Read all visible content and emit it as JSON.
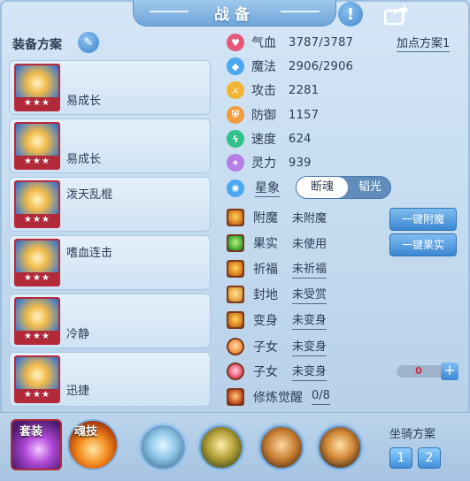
{
  "window": {
    "title": "战备"
  },
  "equipment": {
    "header": "装备方案",
    "items": [
      {
        "label": "易成长",
        "stars": "★★★"
      },
      {
        "label": "易成长",
        "stars": "★★★"
      },
      {
        "label": "泼天乱棍",
        "stars": "★★★"
      },
      {
        "label": "嗜血连击",
        "stars": "★★★"
      },
      {
        "label": "冷静",
        "stars": "★★★"
      },
      {
        "label": "迅捷",
        "stars": "★★★"
      }
    ]
  },
  "stats": {
    "plan_link": "加点方案1",
    "rows": [
      {
        "name": "气血",
        "value": "3787/3787",
        "icon": "heart-icon",
        "color": "#e6577a"
      },
      {
        "name": "魔法",
        "value": "2906/2906",
        "icon": "diamond-icon",
        "color": "#4aa7f0"
      },
      {
        "name": "攻击",
        "value": "2281",
        "icon": "sword-icon",
        "color": "#f2b432"
      },
      {
        "name": "防御",
        "value": "1157",
        "icon": "shield-icon",
        "color": "#f29a3c"
      },
      {
        "name": "速度",
        "value": "624",
        "icon": "lightning-icon",
        "color": "#2fc28b"
      },
      {
        "name": "灵力",
        "value": "939",
        "icon": "spark-icon",
        "color": "#b77ee8"
      }
    ]
  },
  "star_sign": {
    "label": "星象",
    "options": [
      "断魂",
      "韬光"
    ],
    "selected": "断魂"
  },
  "attributes": {
    "rows": [
      {
        "name": "附魔",
        "value": "未附魔",
        "underline": false
      },
      {
        "name": "果实",
        "value": "未使用",
        "underline": false
      },
      {
        "name": "祈福",
        "value": "未祈福",
        "underline": true
      },
      {
        "name": "封地",
        "value": "未受赏",
        "underline": true
      },
      {
        "name": "变身",
        "value": "未变身",
        "underline": true
      },
      {
        "name": "子女",
        "value": "未变身",
        "underline": true
      },
      {
        "name": "子女",
        "value": "未变身",
        "underline": true
      },
      {
        "name": "修炼觉醒",
        "value": "0/8",
        "underline": true
      }
    ],
    "btn_enchant": "一键附魔",
    "btn_fruit": "一键果实",
    "counter_value": "0",
    "counter_plus": "+"
  },
  "bottom": {
    "suit_label": "套装",
    "soul_label": "魂技",
    "mount_title": "坐骑方案",
    "mount_1": "1",
    "mount_2": "2"
  },
  "colors": {
    "accent": "#3b86d2",
    "star_strip": "#b02a3a",
    "counter_text": "#d6283a"
  }
}
